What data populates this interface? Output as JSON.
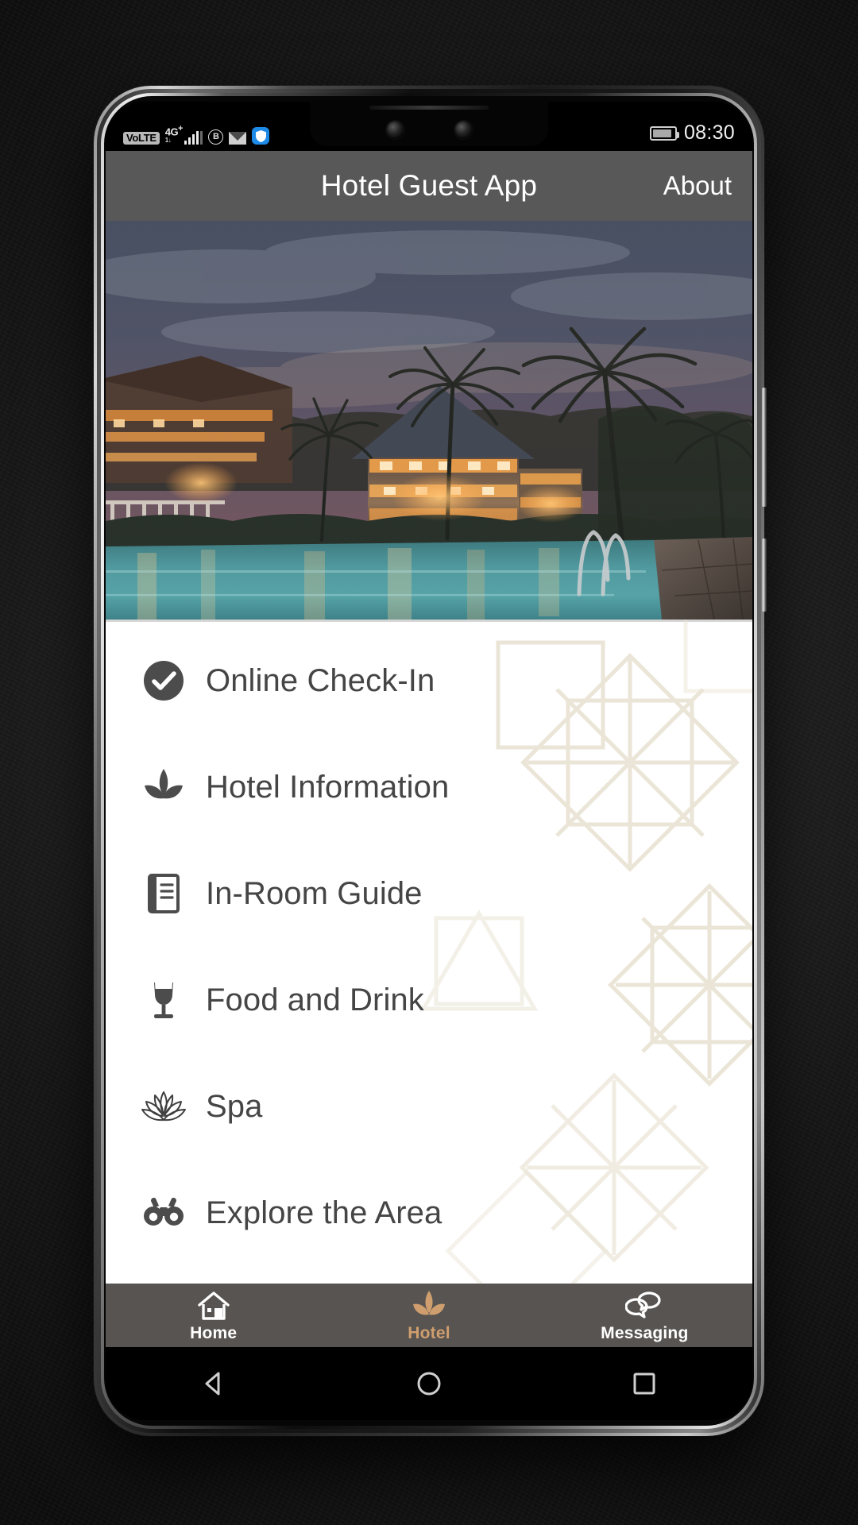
{
  "statusbar": {
    "volte_label": "VoLTE",
    "network_label": "4G",
    "network_sup": "+",
    "network_sub": "1↓",
    "icons": [
      "volte-badge",
      "signal-bars-icon",
      "circle-b-icon",
      "envelope-icon",
      "shield-icon"
    ],
    "circle_b_letter": "B",
    "time": "08:30",
    "battery_level": "88"
  },
  "appbar": {
    "title": "Hotel Guest App",
    "about_label": "About"
  },
  "hero": {
    "alt": "tropical resort hotel at dusk with swimming pool and palm trees"
  },
  "menu": {
    "items": [
      {
        "label": "Online Check-In",
        "icon": "check-circle-icon"
      },
      {
        "label": "Hotel Information",
        "icon": "leaf-icon"
      },
      {
        "label": "In-Room Guide",
        "icon": "document-icon"
      },
      {
        "label": "Food and Drink",
        "icon": "wine-glass-icon"
      },
      {
        "label": "Spa",
        "icon": "lotus-flower-icon"
      },
      {
        "label": "Explore the Area",
        "icon": "binoculars-icon"
      }
    ]
  },
  "tabbar": {
    "tabs": [
      {
        "label": "Home",
        "icon": "house-icon",
        "active": false
      },
      {
        "label": "Hotel",
        "icon": "leaf-icon",
        "active": true
      },
      {
        "label": "Messaging",
        "icon": "chat-bubbles-icon",
        "active": false
      }
    ]
  },
  "navbar": {
    "buttons": [
      {
        "name": "back-button",
        "icon": "triangle-left-icon"
      },
      {
        "name": "home-button",
        "icon": "circle-icon"
      },
      {
        "name": "recents-button",
        "icon": "square-icon"
      }
    ]
  },
  "colors": {
    "appbar_bg": "#585858",
    "tabbar_bg": "#585451",
    "accent_gold": "#cf9e6e",
    "list_text": "#454545",
    "list_bg": "#ffffff",
    "watermark": "#e9e4d5"
  }
}
